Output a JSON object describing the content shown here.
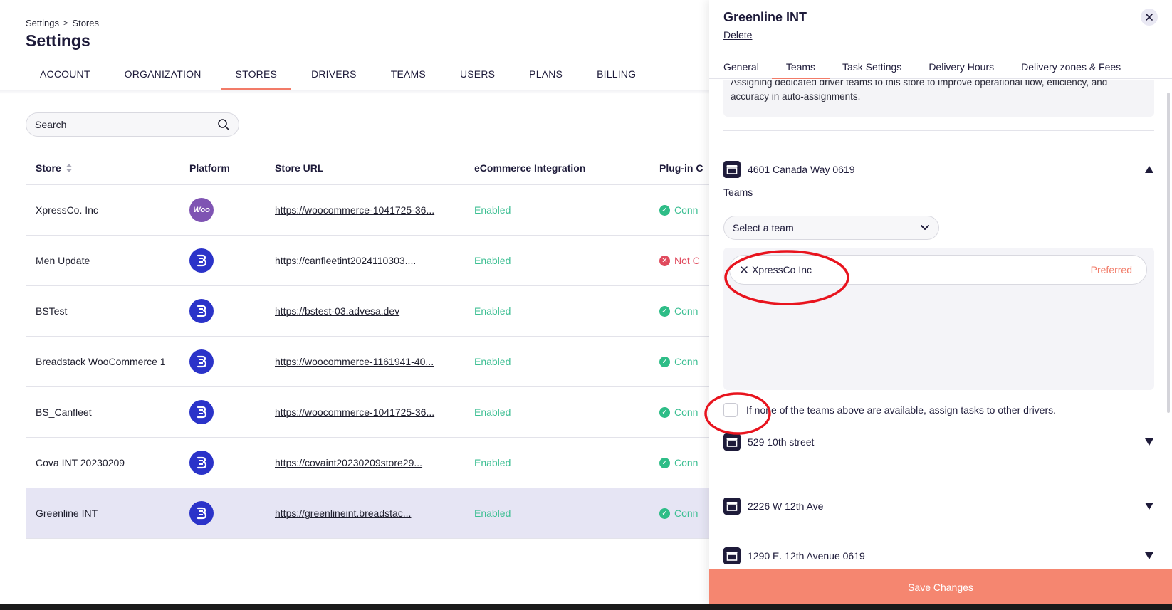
{
  "breadcrumb": {
    "parent": "Settings",
    "separator": ">",
    "current": "Stores"
  },
  "page_title": "Settings",
  "tabs": [
    {
      "label": "ACCOUNT"
    },
    {
      "label": "ORGANIZATION"
    },
    {
      "label": "STORES",
      "active": true
    },
    {
      "label": "DRIVERS"
    },
    {
      "label": "TEAMS"
    },
    {
      "label": "USERS"
    },
    {
      "label": "PLANS"
    },
    {
      "label": "BILLING"
    }
  ],
  "search": {
    "placeholder": "Search",
    "value": ""
  },
  "table": {
    "headers": {
      "store": "Store",
      "platform": "Platform",
      "url": "Store URL",
      "ecommerce": "eCommerce Integration",
      "plugin": "Plug-in C"
    },
    "rows": [
      {
        "store": "XpressCo. Inc",
        "platform": "woocommerce",
        "platform_label": "Woo",
        "url": "https://woocommerce-1041725-36...",
        "ecommerce": "Enabled",
        "plugin": "Conn",
        "plugin_ok": true
      },
      {
        "store": "Men Update",
        "platform": "breadstack",
        "url": "https://canfleetint2024110303....",
        "ecommerce": "Enabled",
        "plugin": "Not C",
        "plugin_ok": false
      },
      {
        "store": "BSTest",
        "platform": "breadstack",
        "url": "https://bstest-03.advesa.dev",
        "ecommerce": "Enabled",
        "plugin": "Conn",
        "plugin_ok": true
      },
      {
        "store": "Breadstack WooCommerce 1",
        "platform": "breadstack",
        "url": "https://woocommerce-1161941-40...",
        "ecommerce": "Enabled",
        "plugin": "Conn",
        "plugin_ok": true
      },
      {
        "store": "BS_Canfleet",
        "platform": "breadstack",
        "url": "https://woocommerce-1041725-36...",
        "ecommerce": "Enabled",
        "plugin": "Conn",
        "plugin_ok": true
      },
      {
        "store": "Cova INT 20230209",
        "platform": "breadstack",
        "url": "https://covaint20230209store29...",
        "ecommerce": "Enabled",
        "plugin": "Conn",
        "plugin_ok": true
      },
      {
        "store": "Greenline INT",
        "platform": "breadstack",
        "url": "https://greenlineint.breadstac...",
        "ecommerce": "Enabled",
        "plugin": "Conn",
        "plugin_ok": true,
        "selected": true
      }
    ]
  },
  "drawer": {
    "title": "Greenline INT",
    "delete_label": "Delete",
    "tabs": [
      {
        "label": "General"
      },
      {
        "label": "Teams",
        "active": true
      },
      {
        "label": "Task Settings"
      },
      {
        "label": "Delivery Hours"
      },
      {
        "label": "Delivery zones & Fees"
      }
    ],
    "info_text": "Assigning dedicated driver teams to this store to improve operational flow, efficiency, and accuracy in auto-assignments.",
    "locations": [
      {
        "name": "4601 Canada Way 0619",
        "expanded": true
      },
      {
        "name": "529 10th street",
        "expanded": false
      },
      {
        "name": "2226 W 12th Ave",
        "expanded": false
      },
      {
        "name": "1290 E. 12th Avenue 0619",
        "expanded": false
      }
    ],
    "teams_label": "Teams",
    "select_placeholder": "Select a team",
    "assigned_team": {
      "name": "XpressCo Inc",
      "tag": "Preferred"
    },
    "fallback_label": "If none of the teams above are available, assign tasks to other drivers.",
    "fallback_checked": false,
    "save_label": "Save Changes"
  },
  "colors": {
    "accent": "#f27b68",
    "save_button": "#f58670",
    "enabled_green": "#3dbf93",
    "error_red": "#e04a5d",
    "selected_row": "#e6e5f4",
    "breadstack_blue": "#2b33c9",
    "woo_purple": "#7f54b3",
    "annotation_red": "#e8141e"
  }
}
